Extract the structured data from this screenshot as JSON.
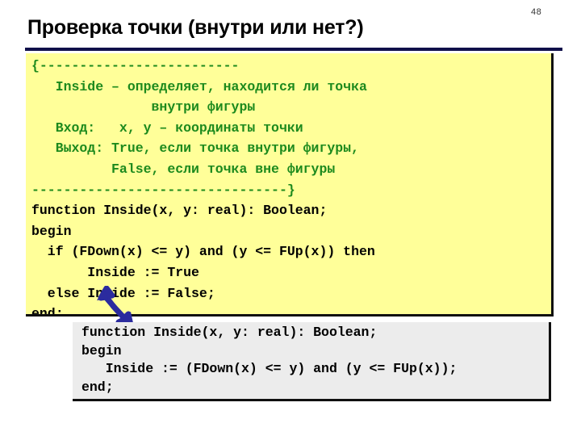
{
  "slide": {
    "number": "48",
    "title": "Проверка точки (внутри или нет?)",
    "accent_color": "#10104a",
    "panel_bg": "#ffff99",
    "panel_alt_bg": "#ececec",
    "comment_color": "#1d8a1d",
    "code_color": "#000000",
    "arrow_color": "#2b2b9e"
  },
  "code_panel": {
    "comment_lines": [
      "{-------------------------",
      "   Inside – определяет, находится ли точка",
      "               внутри фигуры",
      "   Вход:   x, y – координаты точки",
      "   Выход: True, если точка внутри фигуры,",
      "          False, если точка вне фигуры",
      "--------------------------------}"
    ],
    "code_lines": [
      "function Inside(x, y: real): Boolean;",
      "begin",
      "  if (FDown(x) <= y) and (y <= FUp(x)) then",
      "       Inside := True",
      "  else Inside := False;",
      "end;"
    ]
  },
  "gray_panel": {
    "code_lines": [
      "function Inside(x, y: real): Boolean;",
      "begin",
      "   Inside := (FDown(x) <= y) and (y <= FUp(x));",
      "end;"
    ]
  },
  "arrow": {
    "name": "blue-double-arrow"
  }
}
